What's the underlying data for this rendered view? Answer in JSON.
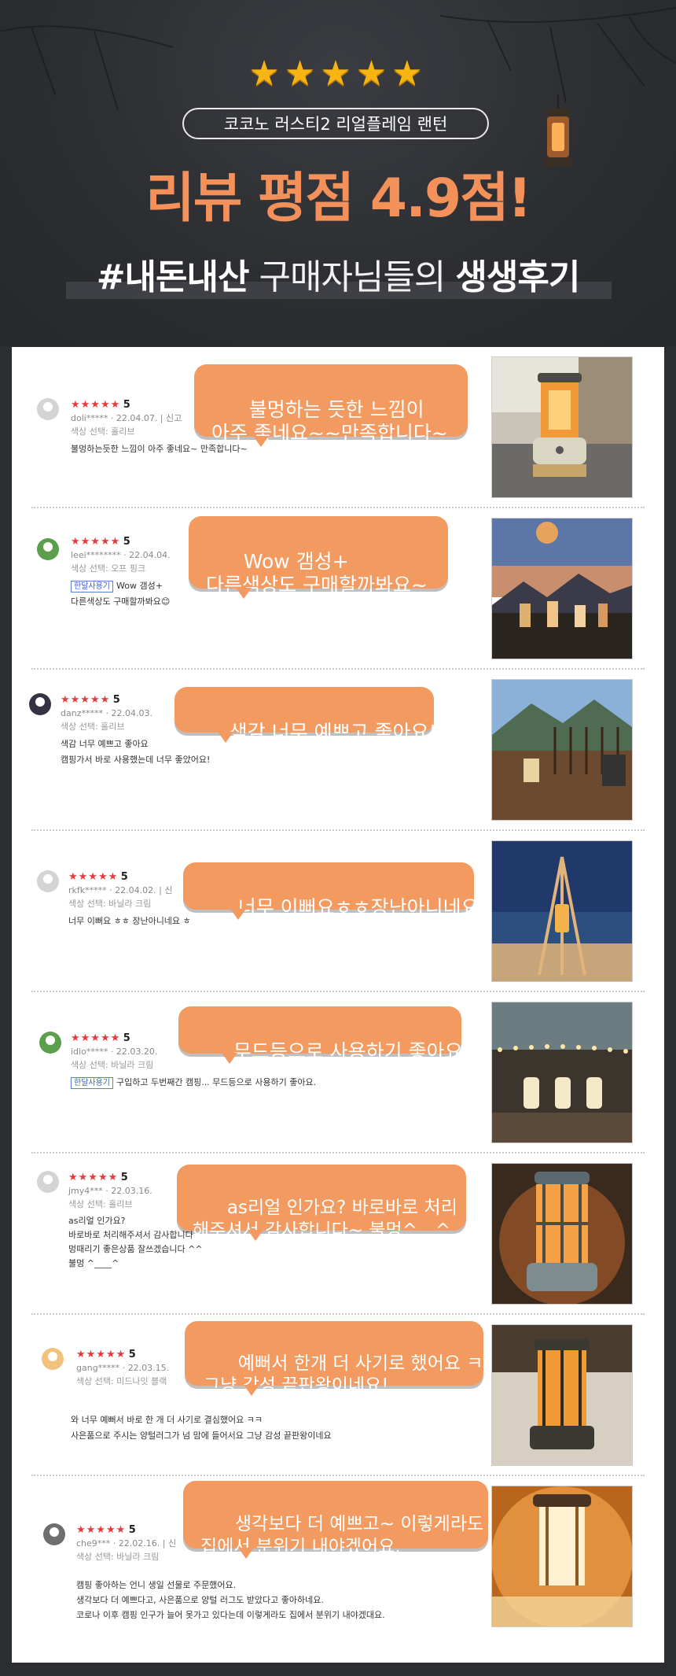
{
  "hero": {
    "stars": "★★★★★",
    "product": "코코노 러스티2 리얼플레임 랜턴",
    "headline": "리뷰 평점 4.9점!",
    "subline_a": "#내돈내산",
    "subline_b": "구매자님들의",
    "subline_c": "생생후기"
  },
  "colors": {
    "accent": "#f4915a",
    "bubble": "#f39a60",
    "background": "#2b2d31",
    "star_red": "#e8393a",
    "star_gold": "#f7b514"
  },
  "reviews": [
    {
      "user": "doli*****",
      "date": "22.04.07.",
      "extra": "신고",
      "stars": "★★★★★",
      "score": "5",
      "option": "색상 선택: 홀리브",
      "tag": "",
      "body": [
        "불멍하는듯한 느낌이 아주 좋네요~ 만족합니다~"
      ],
      "bubble": "불멍하는 듯한 느낌이\n아주 좋네요~~만족합니다~",
      "photo": "lantern-on-table"
    },
    {
      "user": "leei********",
      "date": "22.04.04.",
      "extra": "",
      "stars": "★★★★★",
      "score": "5",
      "option": "색상 선택: 오프 핑크",
      "tag": "한달사용기",
      "body": [
        "Wow 갬성+",
        "다른색상도 구매할까봐요😊"
      ],
      "bubble": "Wow 갬성+\n다른색상도 구매할까봐요~",
      "photo": "lanterns-sunset"
    },
    {
      "user": "danz*****",
      "date": "22.04.03.",
      "extra": "",
      "stars": "★★★★★",
      "score": "5",
      "option": "색상 선택: 홀리브",
      "tag": "",
      "body": [
        "색감 너무 예쁘고 좋아요",
        "캠핑가서 바로 사용했는데  너무 좋았어요!"
      ],
      "bubble": "색감 너무 예쁘고 좋아요!",
      "photo": "deck-mountain"
    },
    {
      "user": "rkfk*****",
      "date": "22.04.02.",
      "extra": "신",
      "stars": "★★★★★",
      "score": "5",
      "option": "색상 선택: 바닐라 크림",
      "tag": "",
      "body": [
        "너무 이뻐요 ㅎㅎ 장난아니네요 ㅎ"
      ],
      "bubble": "너무 이뻐요ㅎㅎ장난아니네요ㅎ",
      "photo": "tripod-beach"
    },
    {
      "user": "idio*****",
      "date": "22.03.20.",
      "extra": "",
      "stars": "★★★★★",
      "score": "5",
      "option": "색상 선택: 바닐라 크림",
      "tag": "한달사용기",
      "body": [
        "구입하고 두번째간 캠핑...  무드등으로 사용하기 좋아요."
      ],
      "bubble": "무드등으로 사용하기 좋아요!",
      "photo": "string-lights"
    },
    {
      "user": "jmy4***",
      "date": "22.03.16.",
      "extra": "",
      "stars": "★★★★★",
      "score": "5",
      "option": "색상 선택: 홀리브",
      "tag": "",
      "body": [
        "as리얼 인가요?",
        "바로바로 처리해주셔서 감사합니다",
        "멍때리기 좋은상품 잘쓰겠습니다 ^^",
        "불멍 ^____^"
      ],
      "bubble": "as리얼 인가요? 바로바로 처리\n해주셔서 감사합니다~ 불멍^__^",
      "photo": "lantern-closeup"
    },
    {
      "user": "gang*****",
      "date": "22.03.15.",
      "extra": "",
      "stars": "★★★★★",
      "score": "5",
      "option": "색상 선택: 미드나잇 블랙",
      "tag": "",
      "body": [
        "와 너무 예뻐서 바로 한 개 더 사기로 결심했어요 ㅋㅋ",
        "사은품으로 주시는 양털러그가 넘 맘에 들어서요  그냥 감성 끝판왕이네요"
      ],
      "bubble": "예뻐서 한개 더 사기로 했어요 ㅋ\n그냥 감성 끝판왕이네요!",
      "photo": "lantern-fur"
    },
    {
      "user": "che9***",
      "date": "22.02.16.",
      "extra": "신",
      "stars": "★★★★★",
      "score": "5",
      "option": "색상 선택: 바닐라 크림",
      "tag": "",
      "body": [
        "캠핑 좋아하는 언니 생일 선물로 주문했어요.",
        "생각보다 더 예쁘다고, 사은품으로 양털 러그도 받았다고 좋아하네요.",
        "코로나 이후 캠핑 인구가 늘어 못가고 있다는데 이렇게라도 집에서 분위기 내야겠대요."
      ],
      "bubble": "생각보다 더 예쁘고~ 이렇게라도\n집에서 분위기 내야겠어요.",
      "photo": "lantern-glow"
    }
  ]
}
